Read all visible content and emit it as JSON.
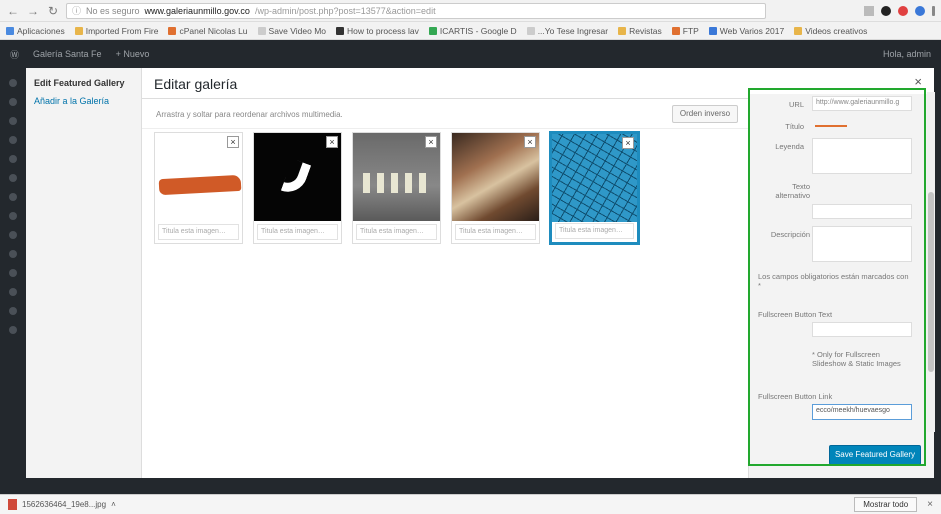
{
  "browser": {
    "insecure_label": "No es seguro",
    "url_domain": "www.galeriaunmillo.gov.co",
    "url_path": "/wp-admin/post.php?post=13577&action=edit",
    "bookmarks": [
      "Aplicaciones",
      "Imported From Fire",
      "cPanel Nicolas Lu",
      "Save Video Mo",
      "How to process lav",
      "ICARTIS - Google D",
      "...Yo Tese Ingresar",
      "Revistas",
      "FTP",
      "Web Varios 2017",
      "Videos creativos"
    ]
  },
  "wp_bar": {
    "site": "Galería Santa Fe",
    "new_label": "+ Nuevo",
    "user": "Hola, admin"
  },
  "modal": {
    "menu_title": "Edit Featured Gallery",
    "menu_link": "Añadir a la Galería",
    "title": "Editar galería",
    "instructions": "Arrastra y soltar para reordenar archivos multimedia.",
    "reverse_button": "Orden inverso",
    "close": "×",
    "thumbnails": [
      {
        "caption": "Titula esta imagen…",
        "remove": "×"
      },
      {
        "caption": "Titula esta imagen…",
        "remove": "×"
      },
      {
        "caption": "Titula esta imagen…",
        "remove": "×"
      },
      {
        "caption": "Titula esta imagen…",
        "remove": "×"
      },
      {
        "caption": "Titula esta imagen…",
        "remove": "×"
      }
    ]
  },
  "settings": {
    "url_label": "URL",
    "url_value": "http://www.galeriaunmillo.g",
    "title_label": "Título",
    "caption_label": "Leyenda",
    "alt_label": "Texto alternativo",
    "description_label": "Descripción",
    "required_note": "Los campos obligatorios están marcados con *",
    "fullscreen_text_label": "Fullscreen Button Text",
    "fullscreen_note": "* Only for Fullscreen Slideshow & Static Images",
    "fullscreen_link_label": "Fullscreen Button Link",
    "fullscreen_link_value": "ecco/meekh/huevaesgo",
    "save_button": "Save Featured Gallery"
  },
  "downloads": {
    "file_name": "1562636464_19e8...jpg",
    "show_all": "Mostrar todo",
    "close": "×"
  },
  "colors": {
    "highlight": "#22a82e",
    "primary": "#0085ba",
    "wp_dark": "#23282d",
    "accent_orange": "#e07030"
  }
}
